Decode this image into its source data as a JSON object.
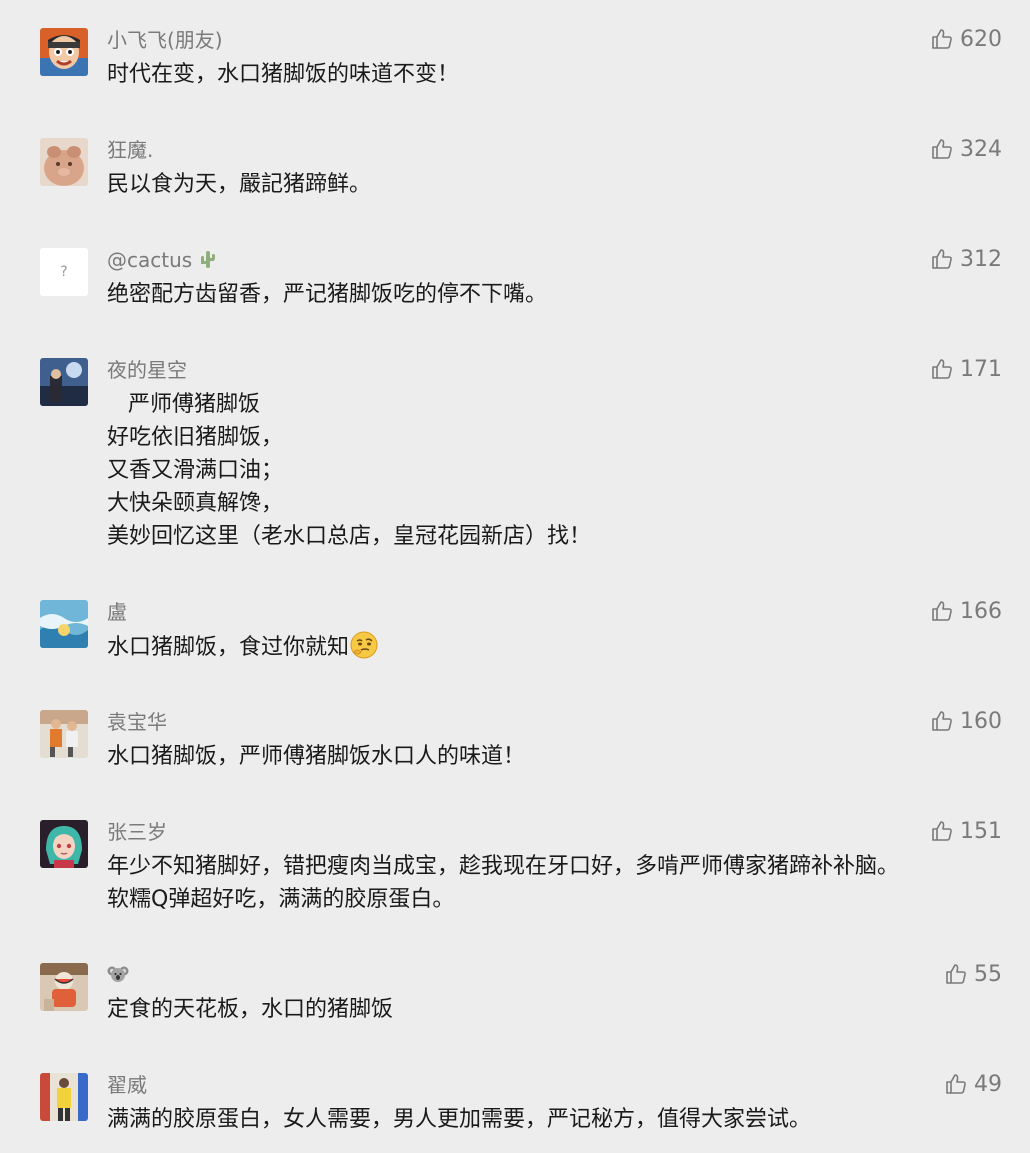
{
  "comments": [
    {
      "nickname": "小飞飞(朋友)",
      "likes": "620",
      "lines": [
        "时代在变，水口猪脚饭的味道不变！"
      ]
    },
    {
      "nickname": "狂魔.",
      "likes": "324",
      "lines": [
        "民以食为天，嚴記猪蹄鲜。"
      ]
    },
    {
      "nickname": "@cactus",
      "avatar_text": "?",
      "likes": "312",
      "lines": [
        "绝密配方齿留香，严记猪脚饭吃的停不下嘴。"
      ]
    },
    {
      "nickname": "夜的星空",
      "likes": "171",
      "lines": [
        "   严师傅猪脚饭",
        "好吃依旧猪脚饭，",
        "又香又滑满口油；",
        "大快朵颐真解馋，",
        "美妙回忆这里（老水口总店，皇冠花园新店）找！"
      ]
    },
    {
      "nickname": "盧",
      "likes": "166",
      "lines": [
        "水口猪脚饭，食过你就知"
      ]
    },
    {
      "nickname": "袁宝华",
      "likes": "160",
      "lines": [
        "水口猪脚饭，严师傅猪脚饭水口人的味道！"
      ]
    },
    {
      "nickname": "张三岁",
      "likes": "151",
      "lines": [
        "年少不知猪脚好，错把瘦肉当成宝，趁我现在牙口好，多啃严师傅家猪蹄补补脑。",
        "软糯Q弹超好吃，满满的胶原蛋白。"
      ]
    },
    {
      "nickname": "",
      "likes": "55",
      "lines": [
        "定食的天花板，水口的猪脚饭"
      ]
    },
    {
      "nickname": "翟威",
      "likes": "49",
      "lines": [
        "满满的胶原蛋白，女人需要，男人更加需要，严记秘方，值得大家尝试。"
      ]
    }
  ],
  "icons": {
    "like": "thumbs-up-icon",
    "cactus": "cactus-icon",
    "koala": "koala-icon",
    "emoji": "thinking-face-emoji"
  },
  "colors": {
    "background": "#ededed",
    "nickname": "#7a7a7a",
    "content": "#1a1a1a"
  }
}
